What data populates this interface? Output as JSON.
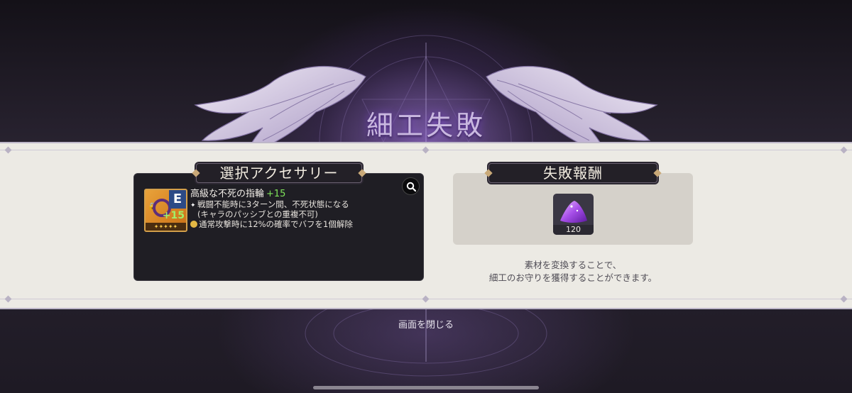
{
  "screen": {
    "title": "細工失敗",
    "close_label": "画面を閉じる"
  },
  "selected_accessory": {
    "header": "選択アクセサリー",
    "item": {
      "name": "高級な不死の指輪",
      "level": "+15",
      "grade": "E",
      "icon_level": "+15",
      "icon": "ring-icon"
    },
    "effects": [
      {
        "icon": "sparkle-icon",
        "line1": "戦闘不能時に3ターン間、不死状態になる",
        "line2": "(キャラのパッシブとの重複不可)"
      },
      {
        "icon": "gold-plus-icon",
        "line1": "通常攻撃時に12%の確率でバフを1個解除"
      }
    ],
    "search_icon": "search-icon"
  },
  "failure_reward": {
    "header": "失敗報酬",
    "items": [
      {
        "icon": "purple-powder-icon",
        "quantity": "120"
      }
    ],
    "description_line1": "素材を変換することで、",
    "description_line2": "細工のお守りを獲得することができます。"
  },
  "colors": {
    "accent_purple": "#b887ff",
    "level_green": "#7fe35a",
    "panel_dark": "#1f1e24",
    "band_light": "#eceae4"
  }
}
